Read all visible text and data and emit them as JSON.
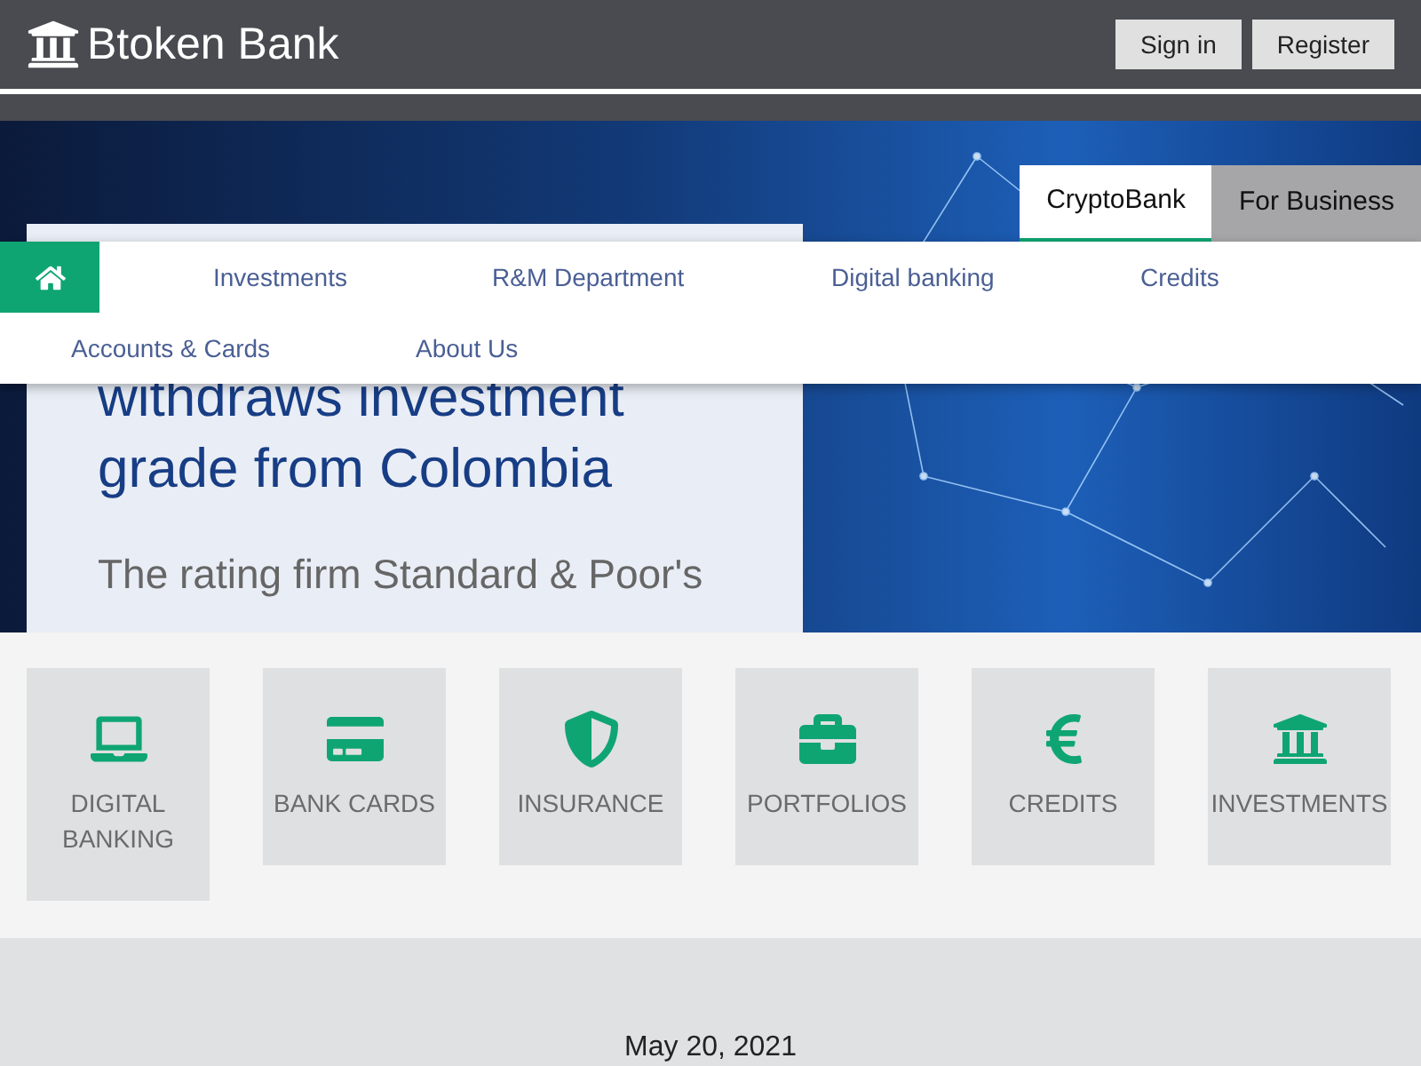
{
  "header": {
    "logo": "Btoken Bank",
    "buttons": [
      "Sign in",
      "Register"
    ]
  },
  "hero_tabs": [
    {
      "label": "CryptoBank",
      "selected": true
    },
    {
      "label": "For Business",
      "selected": false
    }
  ],
  "nav": {
    "items": [
      "Investments",
      "R&M Department",
      "Digital banking",
      "Credits",
      "Accounts & Cards",
      "About Us"
    ]
  },
  "article": {
    "headline": [
      "withdraws investment",
      "grade from Colombia"
    ],
    "summary": "The rating firm Standard & Poor's"
  },
  "services": [
    {
      "label": "DIGITAL BANKING"
    },
    {
      "label": "BANK CARDS"
    },
    {
      "label": "INSURANCE"
    },
    {
      "label": "PORTFOLIOS"
    },
    {
      "label": "CREDITS"
    },
    {
      "label": "INVESTMENTS"
    }
  ],
  "news": {
    "date": "May 20, 2021"
  }
}
